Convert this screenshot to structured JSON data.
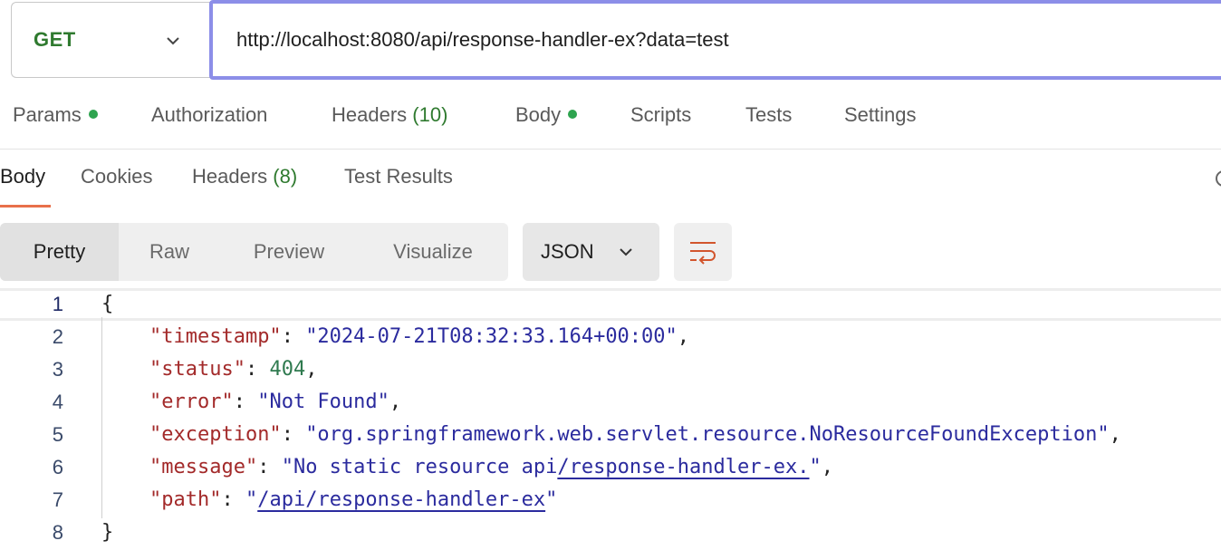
{
  "request": {
    "method": "GET",
    "url": "http://localhost:8080/api/response-handler-ex?data=test"
  },
  "request_tabs": {
    "params": "Params",
    "authorization": "Authorization",
    "headers": "Headers",
    "headers_count": "(10)",
    "body": "Body",
    "scripts": "Scripts",
    "tests": "Tests",
    "settings": "Settings"
  },
  "response_tabs": {
    "body": "Body",
    "cookies": "Cookies",
    "headers": "Headers",
    "headers_count": "(8)",
    "test_results": "Test Results"
  },
  "view_modes": {
    "pretty": "Pretty",
    "raw": "Raw",
    "preview": "Preview",
    "visualize": "Visualize",
    "format": "JSON"
  },
  "code": {
    "line_numbers": [
      "1",
      "2",
      "3",
      "4",
      "5",
      "6",
      "7",
      "8"
    ],
    "open_brace": "{",
    "close_brace": "}",
    "timestamp_key": "\"timestamp\"",
    "timestamp_val": "\"2024-07-21T08:32:33.164+00:00\"",
    "status_key": "\"status\"",
    "status_val": "404",
    "error_key": "\"error\"",
    "error_val": "\"Not Found\"",
    "exception_key": "\"exception\"",
    "exception_val": "\"org.springframework.web.servlet.resource.NoResourceFoundException\"",
    "message_key": "\"message\"",
    "message_val_pre": "\"No static resource api",
    "message_val_link": "/response-handler-ex.",
    "message_val_end": "\"",
    "path_key": "\"path\"",
    "path_val_pre": "\"",
    "path_val_link": "/api/response-handler-ex",
    "path_val_end": "\""
  },
  "colors": {
    "accent": "#e8704a",
    "url_focus": "#8c8ee8",
    "method_green": "#2f7a2f",
    "dot_green": "#2ea44f"
  }
}
